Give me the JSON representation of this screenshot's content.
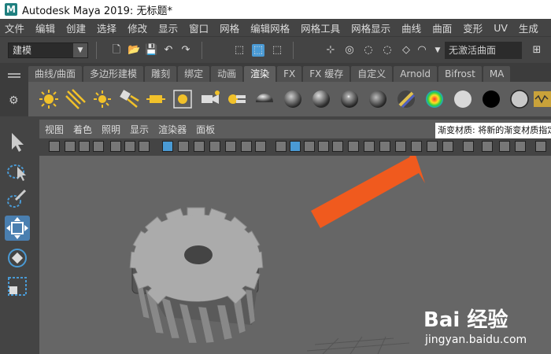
{
  "title_bar": {
    "logo_letter": "M",
    "title": "Autodesk Maya 2019: 无标题*"
  },
  "menu_bar": {
    "items": [
      "文件",
      "编辑",
      "创建",
      "选择",
      "修改",
      "显示",
      "窗口",
      "网格",
      "编辑网格",
      "网格工具",
      "网格显示",
      "曲线",
      "曲面",
      "变形",
      "UV",
      "生成"
    ]
  },
  "status_line": {
    "mode": "建模",
    "no_live_surface": "无激活曲面"
  },
  "shelf": {
    "tabs": [
      "曲线/曲面",
      "多边形建模",
      "雕刻",
      "绑定",
      "动画",
      "渲染",
      "FX",
      "FX 缓存",
      "自定义",
      "Arnold",
      "Bifrost",
      "MA"
    ],
    "active_tab": "渲染",
    "icons": [
      "ambient-light-icon",
      "directional-light-icon",
      "point-light-icon",
      "spot-light-icon",
      "area-light-icon",
      "volume-light-icon",
      "camera-icon",
      "camera-aim-icon",
      "blinn-sphere-icon",
      "lambert-sphere-icon",
      "phong-sphere-icon",
      "phonge-sphere-icon",
      "anisotropic-sphere-icon",
      "layered-shader-icon",
      "ramp-shader-icon",
      "shading-sphere-white-icon",
      "surface-shader-black-icon",
      "use-background-icon",
      "hypershade-icon"
    ]
  },
  "panel": {
    "menu": [
      "视图",
      "着色",
      "照明",
      "显示",
      "渲染器",
      "面板"
    ]
  },
  "tooltip": {
    "text": "渐变材质: 将新的渐变材质指定"
  },
  "watermark": {
    "brand": "Bai 经验",
    "url": "jingyan.baidu.com"
  },
  "colors": {
    "arrow": "#f05a1e",
    "accent": "#4a9ad4",
    "shelf_bg": "#5d5d5d",
    "viewport_bg": "#666666"
  }
}
